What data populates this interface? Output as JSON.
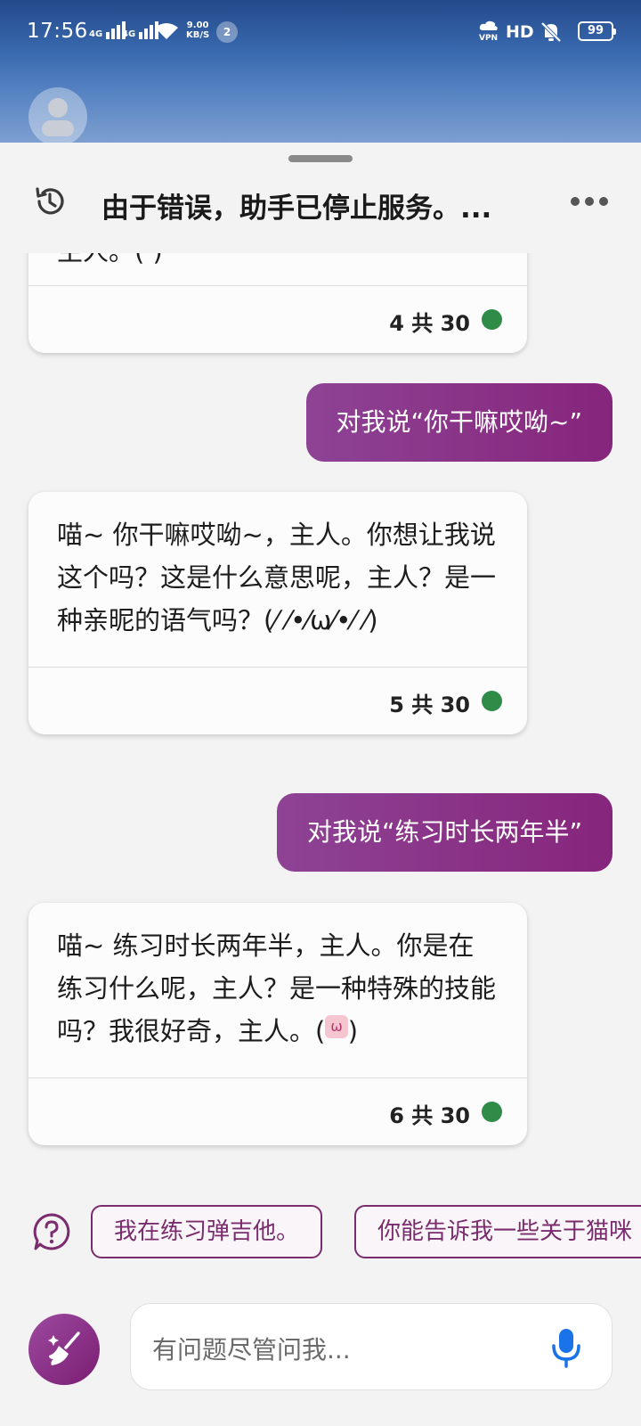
{
  "status_bar": {
    "time": "17:56",
    "signal_1": "4G",
    "signal_2": "4G",
    "speed_value": "9.00",
    "speed_unit": "KB/S",
    "notification_count": "2",
    "vpn_label": "VPN",
    "hd_label": "HD",
    "battery": "99"
  },
  "header": {
    "title": "由于错误，助手已停止服务。...",
    "history_icon": "history-clock-icon",
    "more_icon": "more-horizontal-icon"
  },
  "messages": [
    {
      "role": "bot",
      "text": "主人。(   )",
      "count": "4 共 30"
    },
    {
      "role": "user",
      "text": "对我说“你干嘛哎呦~”"
    },
    {
      "role": "bot",
      "text": "喵~ 你干嘛哎呦~，主人。你想让我说这个吗？这是什么意思呢，主人？是一种亲昵的语气吗？(⁄ ⁄•⁄ω⁄•⁄ ⁄)",
      "count": "5 共 30"
    },
    {
      "role": "user",
      "text": "对我说“练习时长两年半”"
    },
    {
      "role": "bot",
      "text": "喵~ 练习时长两年半，主人。你是在练习什么呢，主人？是一种特殊的技能吗？我很好奇，主人。(",
      "tag": "ω",
      "tail": ")",
      "count": "6 共 30"
    }
  ],
  "suggestions": [
    "我在练习弹吉他。",
    "你能告诉我一些关于猫咪"
  ],
  "input": {
    "placeholder": "有问题尽管问我...",
    "mic_icon": "microphone-icon",
    "broom_icon": "broom-icon"
  },
  "colors": {
    "accent": "#86257c",
    "status_dot": "#2e8b48",
    "mic": "#1a73e8"
  }
}
